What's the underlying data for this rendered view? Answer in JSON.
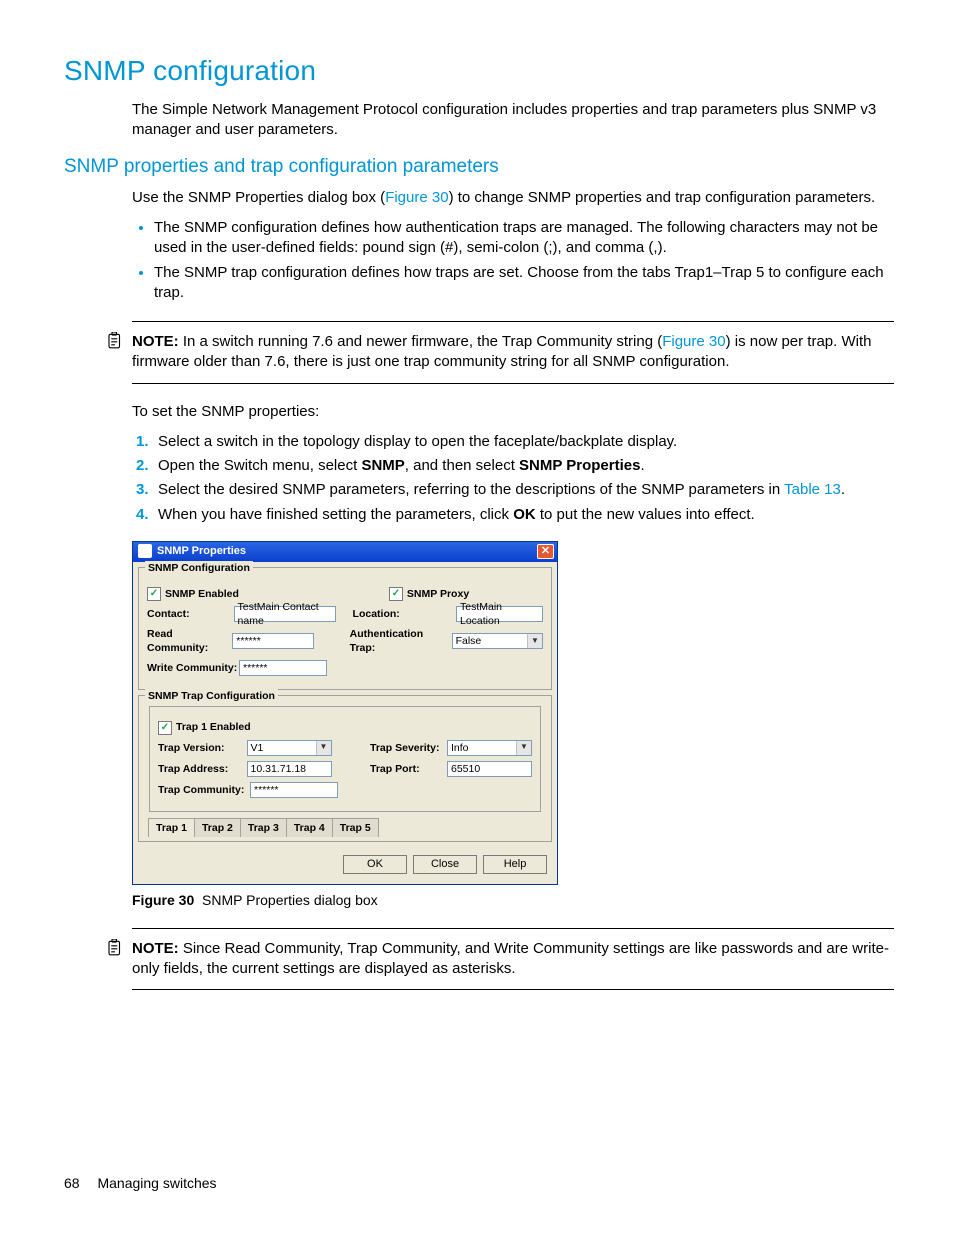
{
  "headings": {
    "h1": "SNMP configuration",
    "h2": "SNMP properties and trap configuration parameters"
  },
  "intro": "The Simple Network Management Protocol configuration includes properties and trap parameters plus SNMP v3 manager and user parameters.",
  "para_use_a": "Use the SNMP Properties dialog box (",
  "fig30_link": "Figure 30",
  "para_use_b": ") to change SNMP properties and trap configuration parameters.",
  "bullets": [
    "The SNMP configuration defines how authentication traps are managed. The following characters may not be used in the user-defined fields: pound sign (#), semi-colon (;), and comma (,).",
    "The SNMP trap configuration defines how traps are set. Choose from the tabs Trap1–Trap 5 to configure each trap."
  ],
  "note1_label": "NOTE:",
  "note1_a": "In a switch running 7.6 and newer firmware, the Trap Community string (",
  "note1_b": ") is now per trap. With firmware older than 7.6, there is just one trap community string for all SNMP configuration.",
  "to_set": "To set the SNMP properties:",
  "steps": {
    "s1": "Select a switch in the topology display to open the faceplate/backplate display.",
    "s2_a": "Open the Switch menu, select ",
    "s2_b": "SNMP",
    "s2_c": ", and then select ",
    "s2_d": "SNMP Properties",
    "s2_e": ".",
    "s3_a": "Select the desired SNMP parameters, referring to the descriptions of the SNMP parameters in ",
    "s3_link": "Table 13",
    "s3_b": ".",
    "s4_a": "When you have finished setting the parameters, click ",
    "s4_b": "OK",
    "s4_c": " to put the new values into effect."
  },
  "dialog": {
    "title": "SNMP Properties",
    "group1_legend": "SNMP Configuration",
    "snmp_enabled": "SNMP Enabled",
    "snmp_proxy": "SNMP Proxy",
    "contact_label": "Contact:",
    "contact_value": "TestMain Contact name",
    "location_label": "Location:",
    "location_value": "TestMain Location",
    "read_label": "Read Community:",
    "read_value": "******",
    "auth_label": "Authentication Trap:",
    "auth_value": "False",
    "write_label": "Write Community:",
    "write_value": "******",
    "group2_legend": "SNMP Trap Configuration",
    "trap1_enabled": "Trap 1 Enabled",
    "trap_version_label": "Trap Version:",
    "trap_version_value": "V1",
    "trap_severity_label": "Trap Severity:",
    "trap_severity_value": "Info",
    "trap_address_label": "Trap Address:",
    "trap_address_value": "10.31.71.18",
    "trap_port_label": "Trap Port:",
    "trap_port_value": "65510",
    "trap_community_label": "Trap Community:",
    "trap_community_value": "******",
    "tabs": [
      "Trap 1",
      "Trap 2",
      "Trap 3",
      "Trap 4",
      "Trap 5"
    ],
    "btn_ok": "OK",
    "btn_close": "Close",
    "btn_help": "Help"
  },
  "figure_caption_label": "Figure 30",
  "figure_caption_text": "SNMP Properties dialog box",
  "note2_label": "NOTE:",
  "note2_text": "Since Read Community, Trap Community, and Write Community settings are like passwords and are write-only fields, the current settings are displayed as asterisks.",
  "footer_page": "68",
  "footer_section": "Managing switches"
}
